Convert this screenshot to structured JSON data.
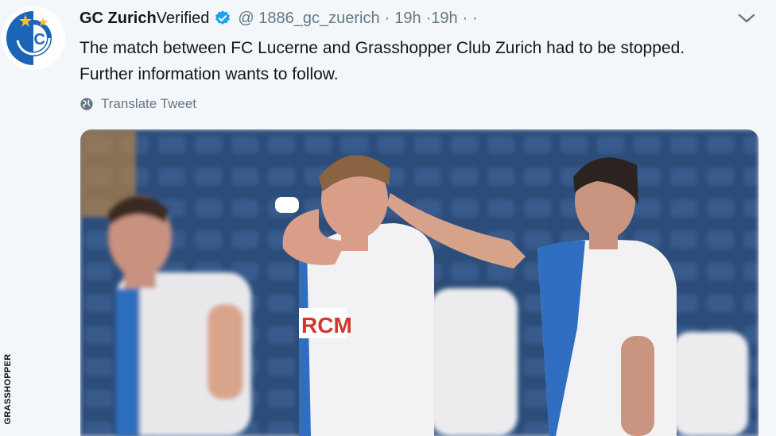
{
  "tweet": {
    "author_name": "GC Zurich",
    "verified_label": "Verified",
    "handle": "@ 1886_gc_zuerich",
    "dot": "·",
    "time": "19h",
    "time_repeat": "·19h",
    "ellipsis": "· ·",
    "text_line1": "The match between FC Lucerne and Grasshopper Club Zurich had to be stopped.",
    "text_line2": "Further information wants to follow.",
    "translate_label": "Translate Tweet"
  },
  "avatar": {
    "logo_letters": "GC"
  },
  "photo": {
    "sponsor_text": "RCM"
  },
  "image_credit": "GRASSHOPPER",
  "colors": {
    "background": "#f3f7f9",
    "accent_blue": "#1da1f2",
    "club_blue": "#1b64b7",
    "star_yellow": "#f2c12e",
    "muted_text": "#657786"
  },
  "icons": [
    "verified-badge-icon",
    "chevron-down-icon",
    "globe-icon",
    "club-logo-icon"
  ]
}
